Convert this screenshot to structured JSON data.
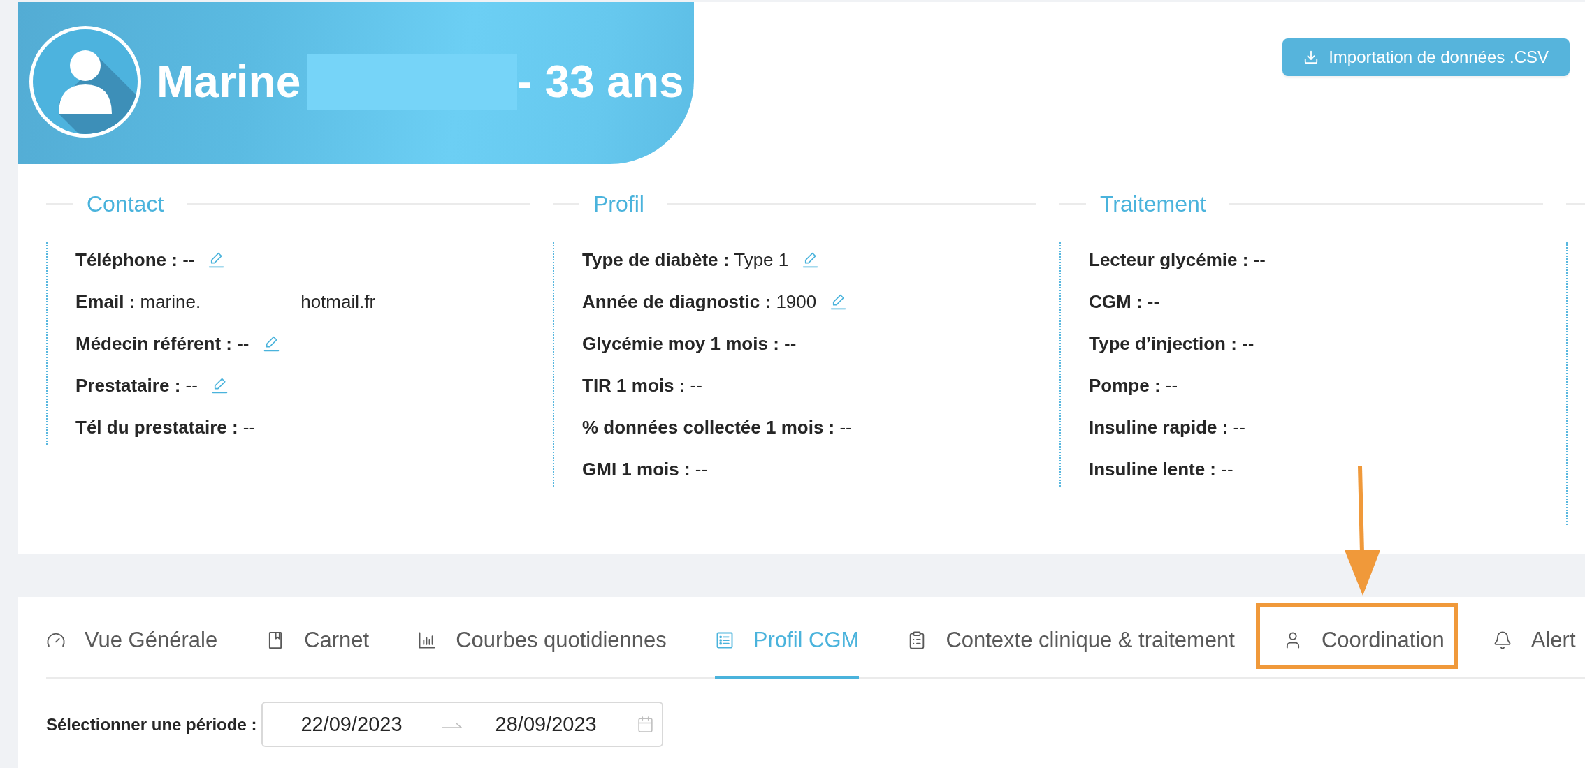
{
  "header": {
    "first_name": "Marine",
    "surname_redacted": true,
    "age": "- 33 ans",
    "import_button": "Importation de données .CSV"
  },
  "sections": [
    {
      "title": "Contact",
      "fields": [
        {
          "text": "**Téléphone :** --",
          "editable": true
        },
        {
          "text": "**Email :** marine.",
          "text_after_gap": "hotmail.fr",
          "editable": false
        },
        {
          "text": "**Médecin référent :** --",
          "editable": true
        },
        {
          "text": "**Prestataire :** --",
          "editable": true
        },
        {
          "text": "**Tél du prestataire :** --",
          "editable": false
        }
      ]
    },
    {
      "title": "Profil",
      "fields": [
        {
          "text": "**Type de diabète :** Type 1",
          "editable": true
        },
        {
          "text": "**Année de diagnostic :** 1900",
          "editable": true
        },
        {
          "text": "**Glycémie moy 1 mois :** --",
          "editable": false
        },
        {
          "text": "**TIR 1 mois :** --",
          "editable": false
        },
        {
          "text": "**% données collectée 1 mois :** --",
          "editable": false
        },
        {
          "text": "**GMI 1 mois :** --",
          "editable": false
        }
      ]
    },
    {
      "title": "Traitement",
      "fields": [
        {
          "text": "**Lecteur glycémie :** --",
          "editable": false
        },
        {
          "text": "**CGM :** --",
          "editable": false
        },
        {
          "text": "**Type d’injection :** --",
          "editable": false
        },
        {
          "text": "**Pompe :** --",
          "editable": false
        },
        {
          "text": "**Insuline rapide :** --",
          "editable": false
        },
        {
          "text": "**Insuline lente :** --",
          "editable": false
        }
      ]
    }
  ],
  "tabs": [
    {
      "label": "Vue Générale",
      "selected": false,
      "highlighted": false
    },
    {
      "label": "Carnet",
      "selected": false,
      "highlighted": false
    },
    {
      "label": "Courbes quotidiennes",
      "selected": false,
      "highlighted": false
    },
    {
      "label": "Profil CGM",
      "selected": true,
      "highlighted": false
    },
    {
      "label": "Contexte clinique & traitement",
      "selected": false,
      "highlighted": false
    },
    {
      "label": "Coordination",
      "selected": false,
      "highlighted": true
    },
    {
      "label": "Alert",
      "selected": false,
      "highlighted": false
    }
  ],
  "period": {
    "label": "Sélectionner une période :",
    "start": "22/09/2023",
    "end": "28/09/2023"
  }
}
